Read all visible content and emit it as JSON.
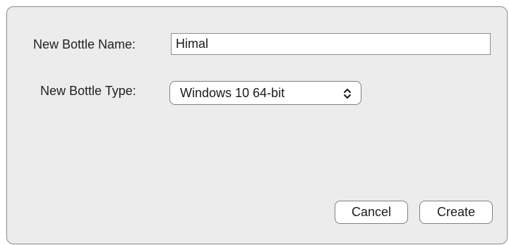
{
  "dialog": {
    "name_label": "New Bottle Name:",
    "name_value": "Himal",
    "type_label": "New Bottle Type:",
    "type_value": "Windows 10 64-bit",
    "cancel_label": "Cancel",
    "create_label": "Create"
  },
  "icons": {
    "popup_arrow": "chevron-up-down-icon"
  }
}
